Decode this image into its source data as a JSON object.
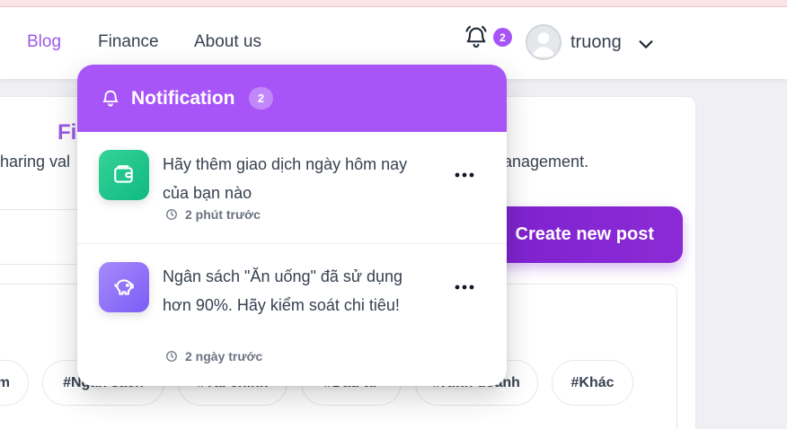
{
  "nav": {
    "links": [
      "Blog",
      "Finance",
      "About us"
    ],
    "notification_badge": "2",
    "username": "truong"
  },
  "background": {
    "title_partial": "Fi",
    "desc_left_partial": "haring val",
    "desc_right_partial": "anagement.",
    "create_button": "Create new post",
    "tags": [
      "m",
      "#Ngân sách",
      "#Tài chính",
      "#Đầu tư",
      "#Kinh doanh",
      "#Khác"
    ]
  },
  "notification": {
    "title": "Notification",
    "count": "2",
    "items": [
      {
        "icon": "wallet-icon",
        "message": "Hãy thêm giao dịch ngày hôm nay của bạn nào",
        "time": "2 phút trước"
      },
      {
        "icon": "piggy-bank-icon",
        "message": "Ngân sách \"Ăn uống\" đã sử dụng hơn 90%. Hãy kiểm soát chi tiêu!",
        "time": "2 ngày trước"
      }
    ]
  },
  "colors": {
    "accent": "#a855f7",
    "button": "#7e22ce",
    "nav_active": "#9b59e6"
  }
}
